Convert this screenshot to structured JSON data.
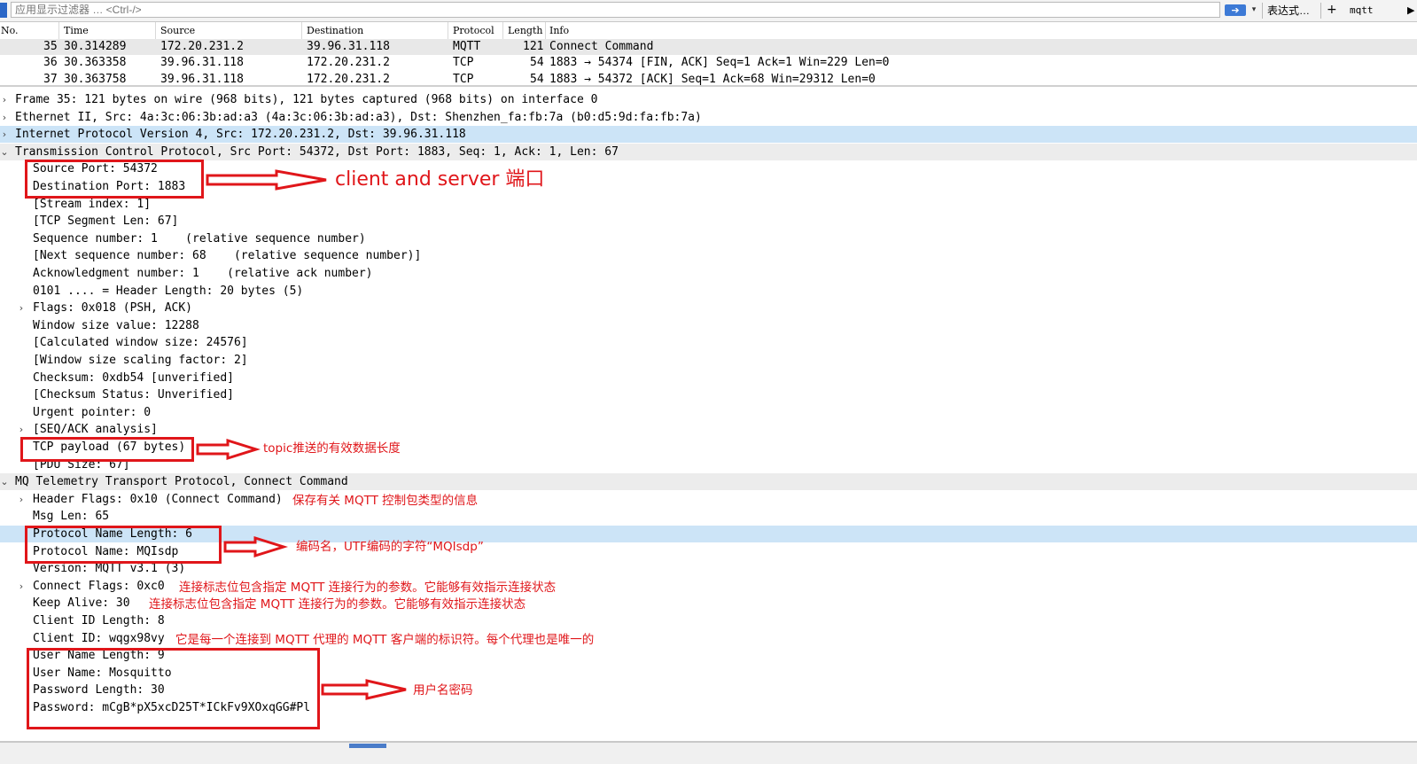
{
  "filter": {
    "placeholder": "应用显示过滤器 … <Ctrl-/>",
    "apply_icon": "arrow-right-icon",
    "dropdown_icon": "▾",
    "expression_label": "表达式…",
    "plus_label": "+",
    "mqtt_label": "mqtt",
    "more_icon": "▶"
  },
  "packet_list": {
    "columns": [
      "No.",
      "Time",
      "Source",
      "Destination",
      "Protocol",
      "Length",
      "Info"
    ],
    "rows": [
      {
        "no": "35",
        "time": "30.314289",
        "src": "172.20.231.2",
        "dst": "39.96.31.118",
        "proto": "MQTT",
        "len": "121",
        "info": "Connect Command"
      },
      {
        "no": "36",
        "time": "30.363358",
        "src": "39.96.31.118",
        "dst": "172.20.231.2",
        "proto": "TCP",
        "len": "54",
        "info": "1883 → 54374 [FIN, ACK] Seq=1 Ack=1 Win=229 Len=0"
      },
      {
        "no": "37",
        "time": "30.363758",
        "src": "39.96.31.118",
        "dst": "172.20.231.2",
        "proto": "TCP",
        "len": "54",
        "info": "1883 → 54372 [ACK] Seq=1 Ack=68 Win=29312 Len=0"
      }
    ]
  },
  "details": [
    {
      "text": "Frame 35: 121 bytes on wire (968 bits), 121 bytes captured (968 bits) on interface 0",
      "arrow": "›"
    },
    {
      "text": "Ethernet II, Src: 4a:3c:06:3b:ad:a3 (4a:3c:06:3b:ad:a3), Dst: Shenzhen_fa:fb:7a (b0:d5:9d:fa:fb:7a)",
      "arrow": "›"
    },
    {
      "text": "Internet Protocol Version 4, Src: 172.20.231.2, Dst: 39.96.31.118",
      "arrow": "›"
    },
    {
      "text": "Transmission Control Protocol, Src Port: 54372, Dst Port: 1883, Seq: 1, Ack: 1, Len: 67",
      "arrow": "⌄"
    },
    {
      "text": "Source Port: 54372",
      "arrow": ""
    },
    {
      "text": "Destination Port: 1883",
      "arrow": ""
    },
    {
      "text": "[Stream index: 1]",
      "arrow": ""
    },
    {
      "text": "[TCP Segment Len: 67]",
      "arrow": ""
    },
    {
      "text": "Sequence number: 1    (relative sequence number)",
      "arrow": ""
    },
    {
      "text": "[Next sequence number: 68    (relative sequence number)]",
      "arrow": ""
    },
    {
      "text": "Acknowledgment number: 1    (relative ack number)",
      "arrow": ""
    },
    {
      "text": "0101 .... = Header Length: 20 bytes (5)",
      "arrow": ""
    },
    {
      "text": "Flags: 0x018 (PSH, ACK)",
      "arrow": "›"
    },
    {
      "text": "Window size value: 12288",
      "arrow": ""
    },
    {
      "text": "[Calculated window size: 24576]",
      "arrow": ""
    },
    {
      "text": "[Window size scaling factor: 2]",
      "arrow": ""
    },
    {
      "text": "Checksum: 0xdb54 [unverified]",
      "arrow": ""
    },
    {
      "text": "[Checksum Status: Unverified]",
      "arrow": ""
    },
    {
      "text": "Urgent pointer: 0",
      "arrow": ""
    },
    {
      "text": "[SEQ/ACK analysis]",
      "arrow": "›"
    },
    {
      "text": "TCP payload (67 bytes)",
      "arrow": ""
    },
    {
      "text": "[PDU Size: 67]",
      "arrow": ""
    },
    {
      "text": "MQ Telemetry Transport Protocol, Connect Command",
      "arrow": "⌄"
    },
    {
      "text": "Header Flags: 0x10 (Connect Command)",
      "arrow": "›"
    },
    {
      "text": "Msg Len: 65",
      "arrow": ""
    },
    {
      "text": "Protocol Name Length: 6",
      "arrow": ""
    },
    {
      "text": "Protocol Name: MQIsdp",
      "arrow": ""
    },
    {
      "text": "Version: MQTT v3.1 (3)",
      "arrow": ""
    },
    {
      "text": "Connect Flags: 0xc0",
      "arrow": "›"
    },
    {
      "text": "Keep Alive: 30",
      "arrow": ""
    },
    {
      "text": "Client ID Length: 8",
      "arrow": ""
    },
    {
      "text": "Client ID: wqgx98vy",
      "arrow": ""
    },
    {
      "text": "User Name Length: 9",
      "arrow": ""
    },
    {
      "text": "User Name: Mosquitto",
      "arrow": ""
    },
    {
      "text": "Password Length: 30",
      "arrow": ""
    },
    {
      "text": "Password: mCgB*pX5xcD25T*ICkFv9XOxqGG#Pl",
      "arrow": ""
    }
  ],
  "annotations": {
    "ports": "client and server 端口",
    "payload": "topic推送的有效数据长度",
    "header_flags": "保存有关 MQTT 控制包类型的信息",
    "protocol_name": "编码名，UTF编码的字符“MQIsdp”",
    "connect_flags": "连接标志位包含指定 MQTT 连接行为的参数。它能够有效指示连接状态",
    "keep_alive": "连接标志位包含指定 MQTT 连接行为的参数。它能够有效指示连接状态",
    "client_id": "它是每一个连接到 MQTT 代理的 MQTT 客户端的标识符。每个代理也是唯一的",
    "credentials": "用户名密码"
  },
  "colors": {
    "annotation_red": "#e0161a",
    "selection_blue": "#cce4f7",
    "selected_row_gray": "#e8e8e8"
  }
}
